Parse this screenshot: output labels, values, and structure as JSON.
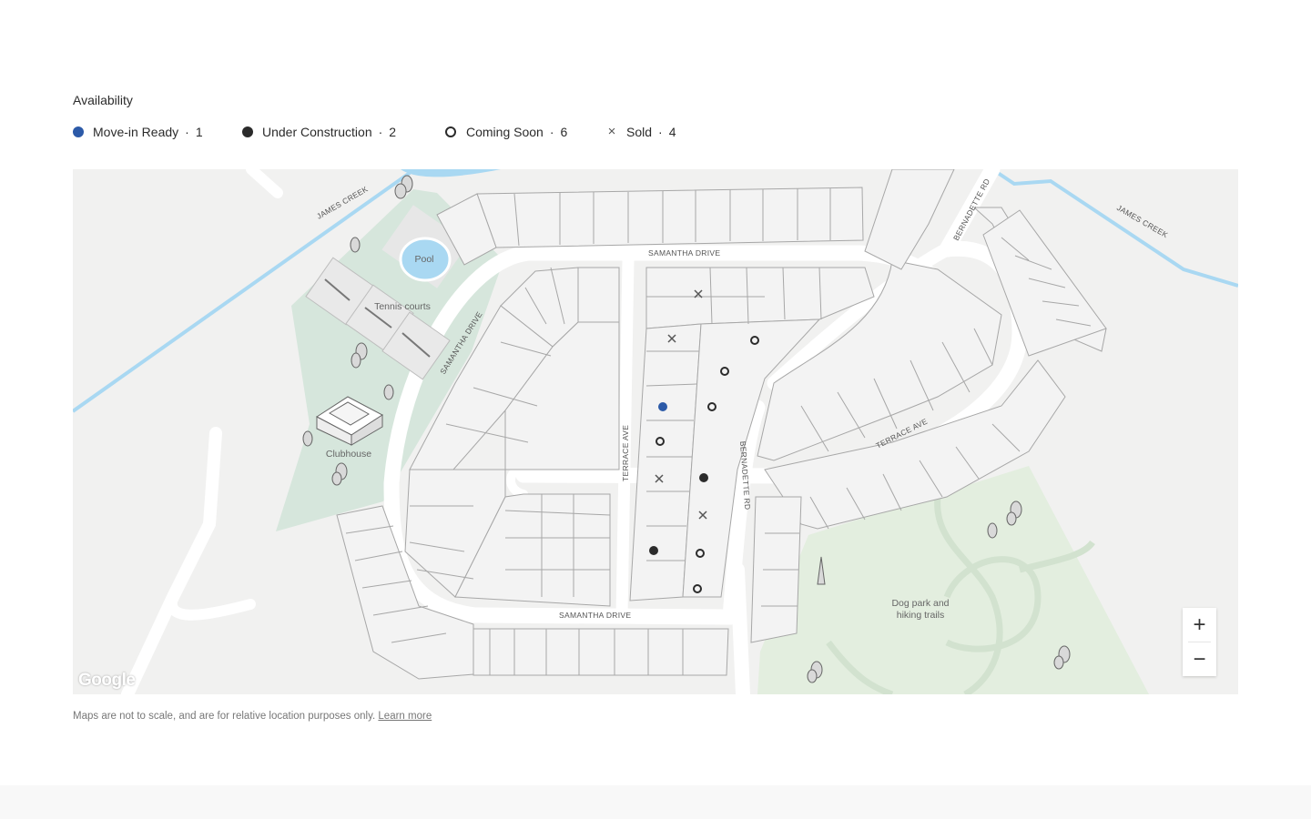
{
  "availability": {
    "title": "Availability",
    "separator": "·",
    "legend": [
      {
        "label": "Move-in Ready",
        "count": "1",
        "status": "ready",
        "color": "#2c5aa8"
      },
      {
        "label": "Under Construction",
        "count": "2",
        "status": "under-construction",
        "color": "#2b2b2b"
      },
      {
        "label": "Coming Soon",
        "count": "6",
        "status": "coming-soon",
        "color": "#2b2b2b"
      },
      {
        "label": "Sold",
        "count": "4",
        "status": "sold",
        "symbol": "×",
        "color": "#555555"
      }
    ]
  },
  "map": {
    "labels": {
      "james_creek_left": "JAMES CREEK",
      "james_creek_right": "JAMES CREEK",
      "samantha_drive_top": "SAMANTHA DRIVE",
      "samantha_drive_left": "SAMANTHA DRIVE",
      "samantha_drive_bottom": "SAMANTHA DRIVE",
      "terrace_ave_vertical": "TERRACE AVE",
      "terrace_ave_diagonal": "TERRACE AVE",
      "bernadette_rd_top": "BERNADETTE RD",
      "bernadette_rd_vertical": "BERNADETTE RD",
      "pool": "Pool",
      "tennis_courts": "Tennis courts",
      "clubhouse": "Clubhouse",
      "dog_park_line1": "Dog park and",
      "dog_park_line2": "hiking trails"
    },
    "zoom": {
      "in_symbol": "+",
      "out_symbol": "−"
    },
    "attribution": "Google",
    "colors": {
      "background": "#f1f1f0",
      "road": "#ffffff",
      "water": "#a9d8f2",
      "amenity_green": "#d6e6dc",
      "park_green": "#e3eedf",
      "lot_fill": "#f3f3f3",
      "lot_stroke": "#a7a7a7"
    }
  },
  "disclaimer": {
    "text": "Maps are not to scale, and are for relative location purposes only.",
    "link": "Learn more"
  }
}
